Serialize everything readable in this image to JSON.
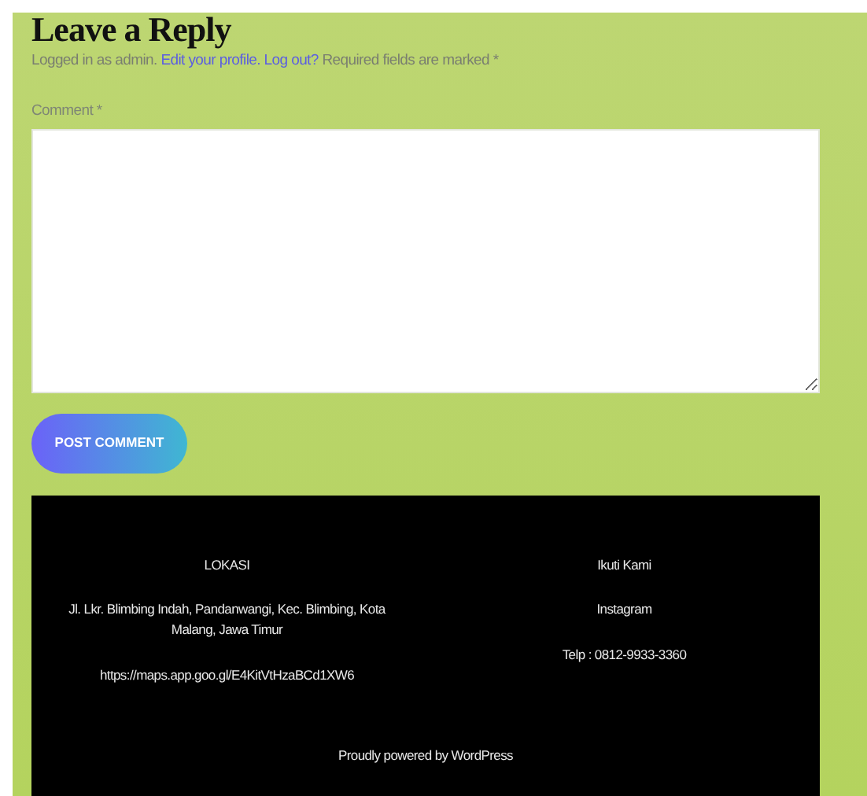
{
  "heading": "Leave a Reply",
  "notice": {
    "before": "Logged in as admin.",
    "links": [
      "Edit your profile.",
      "Log out?"
    ],
    "after": "Required fields are marked *"
  },
  "comment": {
    "label": "Comment *"
  },
  "submit": "POST COMMENT",
  "footer": {
    "columns": [
      {
        "title": "LOKASI",
        "lines": [
          "Jl. Lkr. Blimbing Indah, Pandanwangi, Kec. Blimbing, Kota Malang, Jawa Timur",
          "https://maps.app.goo.gl/E4KitVtHzaBCd1XW6"
        ]
      },
      {
        "title": "Ikuti Kami",
        "lines": [
          "Instagram",
          "Telp : 0812-9933-3360"
        ]
      }
    ],
    "credit": "Proudly powered by WordPress"
  }
}
